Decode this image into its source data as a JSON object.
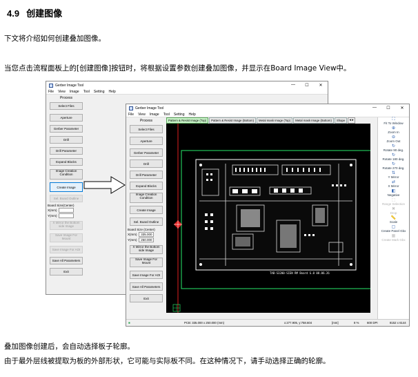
{
  "heading": {
    "number": "4.9",
    "title": "创建图像"
  },
  "para1": "下文将介绍如何创建叠加图像。",
  "para2": "当您点击流程面板上的[创建图像]按钮时，将根据设置参数创建叠加图像，并显示在Board Image View中。",
  "para3": "叠加图像创建后，会自动选择板子轮廓。",
  "para4": "由于最外层线被提取为板的外部形状，它可能与实际板不同。在这种情况下，请手动选择正确的轮廓。",
  "back_window": {
    "title": "Gerber Image Tool",
    "menu": [
      "File",
      "View",
      "Image",
      "Tool",
      "Setting",
      "Help"
    ],
    "process_label": "Process",
    "buttons": [
      "Select Files",
      "Aperture",
      "Gerber Parameter",
      "Drill",
      "Drill Parameter",
      "Expand Blocks",
      "Image Creation Condition",
      "Create Image",
      "Sel. Board Outline"
    ],
    "board_size_label": "Board Size(Center)",
    "x_label": "X(mm)",
    "y_label": "Y(mm)",
    "buttons2": [
      "X Mirror the Bottom side Image",
      "Save Image For Mount",
      "Save Image For AOI",
      "Save All Parameters",
      "Exit"
    ]
  },
  "front_window": {
    "title": "Gerber Image Tool",
    "menu": [
      "File",
      "View",
      "Image",
      "Tool",
      "Setting",
      "Help"
    ],
    "process_label": "Process",
    "buttons": [
      "Select Files",
      "Aperture",
      "Gerber Parameter",
      "Drill",
      "Drill Parameter",
      "Expand Blocks",
      "Image Creation Condition",
      "Create Image",
      "Sel. Board Outline"
    ],
    "board_size_label": "Board Size (Center)",
    "x_label": "X(mm)",
    "x_value": "335.000",
    "y_label": "Y(mm)",
    "y_value": "250.000",
    "buttons2": [
      "X Mirror the Bottom side Image",
      "Save Image For Mount",
      "Save Image For AOI",
      "Save All Parameters",
      "Exit"
    ],
    "tabs": [
      "Pattern & Resist Image (Top)",
      "Pattern & Resist Image (Bottom)",
      "Metal mask Image (Top)",
      "Metal mask Image (Bottom)",
      "Shape"
    ],
    "tab_arrows": "◂ ▸",
    "right_tools": [
      {
        "icon": "fit-to-window-icon",
        "glyph": "⛶",
        "label": "Fit To Window",
        "enabled": true
      },
      {
        "icon": "zoom-in-icon",
        "glyph": "⊕",
        "label": "Zoom In",
        "enabled": true
      },
      {
        "icon": "zoom-out-icon",
        "glyph": "⊖",
        "label": "Zoom Out",
        "enabled": true
      },
      {
        "icon": "rotate-90-icon",
        "glyph": "↻",
        "label": "Rotate 90 deg.",
        "enabled": true
      },
      {
        "icon": "rotate-180-icon",
        "glyph": "↻",
        "label": "Rotate 180 deg.",
        "enabled": true
      },
      {
        "icon": "rotate-270-icon",
        "glyph": "↻",
        "label": "Rotate 270 deg.",
        "enabled": true
      },
      {
        "icon": "y-mirror-icon",
        "glyph": "⇅",
        "label": "Y Mirror",
        "enabled": true
      },
      {
        "icon": "x-mirror-icon",
        "glyph": "⇄",
        "label": "X Mirror",
        "enabled": true
      },
      {
        "icon": "negative-icon",
        "glyph": "◧",
        "label": "Negative",
        "enabled": true
      },
      {
        "icon": "range-selection-icon",
        "glyph": "⬚",
        "label": "Range Selection",
        "enabled": false
      },
      {
        "icon": "drop-icon",
        "glyph": "✖",
        "label": "Drop",
        "enabled": false
      },
      {
        "icon": "scale-icon",
        "glyph": "📏",
        "label": "Scale",
        "enabled": true
      },
      {
        "icon": "create-panel-gbx-icon",
        "glyph": "▢",
        "label": "Create Panel Gbx",
        "enabled": true
      },
      {
        "icon": "create-mark-gbx-icon",
        "glyph": "▦",
        "label": "Create Mark Gbx",
        "enabled": false
      }
    ],
    "pcb_label": "TAB-S3200-SIEN RM Board   G.0   08.06.26",
    "status": {
      "pcb": "PCB: 335.000 x 250.000 (mm)",
      "cursor": "x:277.905, y:758.604",
      "unit": "[mm]",
      "zoom": "8 %",
      "dpi": "600 DPI",
      "size": "8152 x 6144"
    },
    "colors": {
      "tab_active": "#c9f3c9",
      "board_outline": "#22c35a",
      "marker": "#e02020"
    }
  }
}
